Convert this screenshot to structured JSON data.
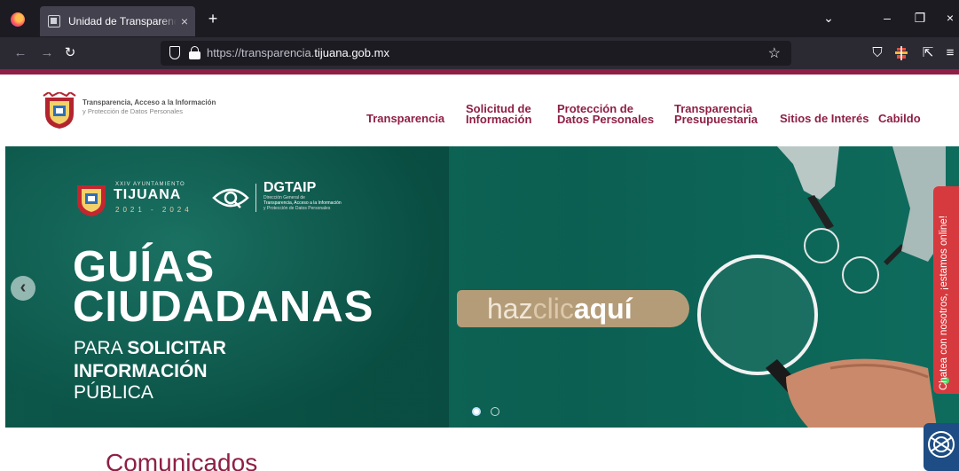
{
  "browser": {
    "tab_title": "Unidad de Transparencia Tijuana",
    "url_prefix": "https://transparencia.",
    "url_domain": "tijuana.gob.mx",
    "tab_close": "×",
    "new_tab": "+",
    "controls": {
      "list": "⌄",
      "minimize": "–",
      "restore": "❐",
      "close": "×"
    },
    "nav": {
      "back": "←",
      "forward": "→",
      "reload": "↻",
      "bookmark": "☆",
      "pocket": "⛉",
      "extensions": "⇱",
      "menu": "≡"
    }
  },
  "header": {
    "logo_line1": "Transparencia, Acceso a la Información",
    "logo_line2": "y Protección de Datos Personales",
    "menu": [
      {
        "label": "Transparencia"
      },
      {
        "label": "Solicitud de Información"
      },
      {
        "label": "Protección de Datos Personales"
      },
      {
        "label": "Transparencia Presupuestaria"
      },
      {
        "label": "Sitios de Interés"
      },
      {
        "label": "Cabildo"
      }
    ]
  },
  "hero": {
    "ayuntamiento": "XXIV AYUNTAMIENTO",
    "city": "TIJUANA",
    "years": "2021 - 2024",
    "dgtaip": "DGTAIP",
    "dgtaip_line1": "Dirección General de",
    "dgtaip_line2": "Transparencia, Acceso a la Información",
    "dgtaip_line3": "y Protección de Datos Personales",
    "title_line1": "GUÍAS",
    "title_line2": "CIUDADANAS",
    "sub_para": "PARA ",
    "sub_solicitar": "SOLICITAR",
    "sub_info": "INFORMACIÓN",
    "sub_publica": "PÚBLICA",
    "cta_part1": "haz",
    "cta_part2": "clic",
    "cta_part3": "aquí",
    "prev": "‹",
    "slides_total": 2,
    "slide_active": 1
  },
  "chat": {
    "label": "Chatea con nosotros, ¡estamos online!"
  },
  "section": {
    "title": "Comunicados"
  },
  "colors": {
    "brand": "#8f1f45",
    "hero_bg": "#0c6354",
    "cta": "#b49c78",
    "chat": "#d63a3e",
    "accessibility": "#1d4d84"
  },
  "icons": [
    "firefox-icon",
    "page-icon",
    "shield-icon",
    "lock-icon",
    "star-icon",
    "pocket-icon",
    "extension-icon",
    "menu-icon",
    "eye-icon",
    "magnifier-icon",
    "accessibility-icon"
  ]
}
